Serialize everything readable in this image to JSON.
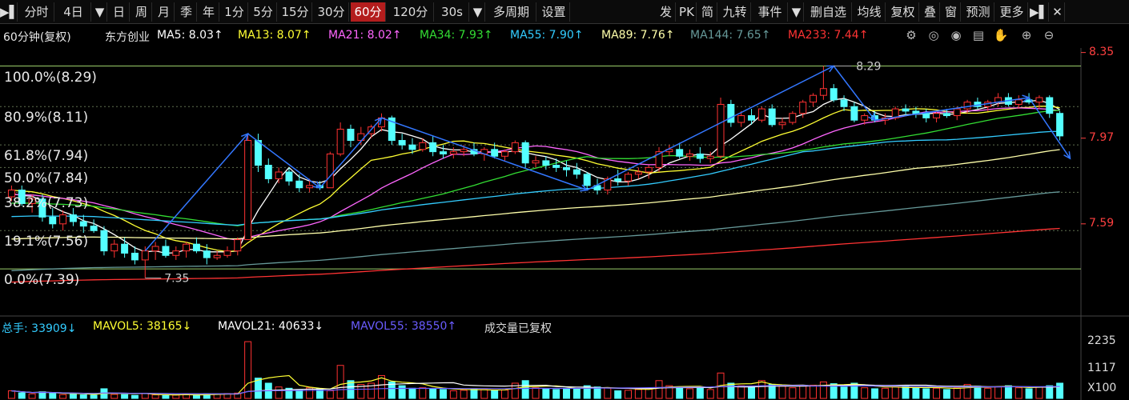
{
  "toolbar": {
    "items": [
      {
        "label": "▶▌",
        "icon": "play-bar-icon"
      },
      {
        "label": "分时"
      },
      {
        "label": "4日"
      },
      {
        "label": "▼",
        "icon": "chevron-down-icon"
      },
      {
        "label": "日"
      },
      {
        "label": "周"
      },
      {
        "label": "月"
      },
      {
        "label": "季"
      },
      {
        "label": "年"
      },
      {
        "label": "1分"
      },
      {
        "label": "5分"
      },
      {
        "label": "15分"
      },
      {
        "label": "30分"
      },
      {
        "label": "60分",
        "active": true
      },
      {
        "label": "120分"
      },
      {
        "label": "30s"
      },
      {
        "label": "▼",
        "icon": "chevron-down-icon"
      },
      {
        "label": "多周期"
      },
      {
        "label": "设置"
      },
      {
        "label": "发"
      },
      {
        "label": "PK"
      },
      {
        "label": "简"
      },
      {
        "label": "九转"
      },
      {
        "label": "事件"
      },
      {
        "label": "▼",
        "icon": "chevron-down-icon"
      },
      {
        "label": "删自选"
      },
      {
        "label": "均线"
      },
      {
        "label": "复权"
      },
      {
        "label": "叠"
      },
      {
        "label": "窗"
      },
      {
        "label": "预测"
      },
      {
        "label": "更多"
      },
      {
        "label": "▶▌",
        "icon": "play-bar-icon"
      },
      {
        "label": "✕",
        "icon": "close-icon"
      }
    ]
  },
  "header": {
    "period": "60分钟(复权)",
    "stock": "东方创业",
    "ma": [
      {
        "label": "MA5: 8.03↑",
        "color": "#ffffff"
      },
      {
        "label": "MA13: 8.07↑",
        "color": "#ffff33"
      },
      {
        "label": "MA21: 8.02↑",
        "color": "#ff66ff"
      },
      {
        "label": "MA34: 7.93↑",
        "color": "#33dd33"
      },
      {
        "label": "MA55: 7.90↑",
        "color": "#33ccff"
      },
      {
        "label": "MA89: 7.76↑",
        "color": "#ffffaa"
      },
      {
        "label": "MA144: 7.65↑",
        "color": "#669999"
      },
      {
        "label": "MA233: 7.44↑",
        "color": "#ff3333"
      }
    ],
    "controls": [
      "gear-icon",
      "eye-circle-icon",
      "eye-icon",
      "clipboard-icon",
      "hand-icon",
      "zoom-in-icon",
      "zoom-out-icon"
    ]
  },
  "chart_data": {
    "type": "candlestick",
    "price_axis": {
      "ticks": [
        8.35,
        7.97,
        7.59
      ],
      "ylim": [
        7.27,
        8.37
      ]
    },
    "fibonacci": [
      {
        "label": "100.0%(8.29)",
        "price": 8.29
      },
      {
        "label": "80.9%(8.11)",
        "price": 8.11
      },
      {
        "label": "61.8%(7.94)",
        "price": 7.94
      },
      {
        "label": "50.0%(7.84)",
        "price": 7.84
      },
      {
        "label": "38.2%(7.73)",
        "price": 7.73
      },
      {
        "label": "19.1%(7.56)",
        "price": 7.56
      },
      {
        "label": "0.0%(7.39)",
        "price": 7.39
      }
    ],
    "annotations": [
      {
        "label": "8.29",
        "price": 8.29
      },
      {
        "label": "7.35",
        "price": 7.35
      }
    ],
    "candles": [
      [
        7.71,
        7.76,
        7.69,
        7.74
      ],
      [
        7.74,
        7.76,
        7.67,
        7.68
      ],
      [
        7.68,
        7.72,
        7.64,
        7.7
      ],
      [
        7.7,
        7.72,
        7.6,
        7.62
      ],
      [
        7.62,
        7.66,
        7.57,
        7.59
      ],
      [
        7.59,
        7.65,
        7.56,
        7.63
      ],
      [
        7.63,
        7.66,
        7.58,
        7.6
      ],
      [
        7.6,
        7.63,
        7.55,
        7.58
      ],
      [
        7.58,
        7.61,
        7.55,
        7.56
      ],
      [
        7.56,
        7.58,
        7.45,
        7.47
      ],
      [
        7.47,
        7.52,
        7.44,
        7.5
      ],
      [
        7.5,
        7.53,
        7.44,
        7.46
      ],
      [
        7.46,
        7.49,
        7.41,
        7.43
      ],
      [
        7.43,
        7.49,
        7.35,
        7.47
      ],
      [
        7.47,
        7.51,
        7.43,
        7.49
      ],
      [
        7.49,
        7.52,
        7.44,
        7.45
      ],
      [
        7.45,
        7.49,
        7.43,
        7.47
      ],
      [
        7.47,
        7.51,
        7.44,
        7.5
      ],
      [
        7.5,
        7.53,
        7.46,
        7.47
      ],
      [
        7.47,
        7.5,
        7.41,
        7.44
      ],
      [
        7.44,
        7.47,
        7.43,
        7.45
      ],
      [
        7.45,
        7.49,
        7.44,
        7.47
      ],
      [
        7.47,
        7.53,
        7.45,
        7.52
      ],
      [
        7.52,
        7.99,
        7.52,
        7.96
      ],
      [
        7.96,
        7.99,
        7.82,
        7.85
      ],
      [
        7.85,
        7.88,
        7.77,
        7.79
      ],
      [
        7.79,
        7.84,
        7.77,
        7.82
      ],
      [
        7.82,
        7.84,
        7.76,
        7.78
      ],
      [
        7.78,
        7.81,
        7.73,
        7.75
      ],
      [
        7.75,
        7.79,
        7.73,
        7.76
      ],
      [
        7.76,
        7.78,
        7.74,
        7.75
      ],
      [
        7.75,
        7.91,
        7.75,
        7.9
      ],
      [
        7.9,
        8.04,
        7.89,
        8.01
      ],
      [
        8.01,
        8.03,
        7.93,
        7.96
      ],
      [
        7.96,
        8.02,
        7.94,
        7.99
      ],
      [
        7.99,
        8.03,
        7.97,
        8.02
      ],
      [
        8.02,
        8.08,
        8.0,
        8.06
      ],
      [
        8.06,
        8.07,
        7.94,
        7.96
      ],
      [
        7.96,
        7.99,
        7.92,
        7.94
      ],
      [
        7.94,
        7.97,
        7.9,
        7.92
      ],
      [
        7.92,
        7.97,
        7.91,
        7.95
      ],
      [
        7.95,
        7.98,
        7.89,
        7.91
      ],
      [
        7.91,
        7.94,
        7.88,
        7.9
      ],
      [
        7.9,
        7.93,
        7.88,
        7.91
      ],
      [
        7.91,
        7.94,
        7.89,
        7.92
      ],
      [
        7.92,
        7.95,
        7.89,
        7.9
      ],
      [
        7.9,
        7.93,
        7.87,
        7.92
      ],
      [
        7.92,
        7.95,
        7.88,
        7.89
      ],
      [
        7.89,
        7.92,
        7.87,
        7.91
      ],
      [
        7.91,
        7.96,
        7.9,
        7.95
      ],
      [
        7.95,
        7.96,
        7.84,
        7.86
      ],
      [
        7.86,
        7.89,
        7.84,
        7.87
      ],
      [
        7.87,
        7.89,
        7.83,
        7.85
      ],
      [
        7.85,
        7.88,
        7.82,
        7.84
      ],
      [
        7.84,
        7.87,
        7.8,
        7.83
      ],
      [
        7.83,
        7.86,
        7.79,
        7.81
      ],
      [
        7.81,
        7.82,
        7.74,
        7.76
      ],
      [
        7.76,
        7.79,
        7.72,
        7.74
      ],
      [
        7.74,
        7.8,
        7.72,
        7.79
      ],
      [
        7.79,
        7.83,
        7.76,
        7.78
      ],
      [
        7.78,
        7.82,
        7.76,
        7.81
      ],
      [
        7.81,
        7.84,
        7.79,
        7.82
      ],
      [
        7.82,
        7.85,
        7.79,
        7.84
      ],
      [
        7.84,
        7.93,
        7.82,
        7.91
      ],
      [
        7.91,
        7.94,
        7.89,
        7.92
      ],
      [
        7.92,
        7.95,
        7.88,
        7.89
      ],
      [
        7.89,
        7.92,
        7.87,
        7.9
      ],
      [
        7.9,
        7.93,
        7.86,
        7.88
      ],
      [
        7.88,
        7.91,
        7.86,
        7.89
      ],
      [
        7.89,
        8.15,
        7.88,
        8.12
      ],
      [
        8.12,
        8.14,
        8.02,
        8.04
      ],
      [
        8.04,
        8.09,
        8.02,
        8.07
      ],
      [
        8.07,
        8.1,
        8.03,
        8.05
      ],
      [
        8.05,
        8.11,
        8.04,
        8.1
      ],
      [
        8.1,
        8.12,
        8.02,
        8.03
      ],
      [
        8.03,
        8.06,
        8.01,
        8.04
      ],
      [
        8.04,
        8.09,
        8.03,
        8.08
      ],
      [
        8.08,
        8.14,
        8.06,
        8.13
      ],
      [
        8.13,
        8.17,
        8.11,
        8.16
      ],
      [
        8.16,
        8.29,
        8.14,
        8.19
      ],
      [
        8.19,
        8.21,
        8.13,
        8.14
      ],
      [
        8.14,
        8.16,
        8.09,
        8.11
      ],
      [
        8.11,
        8.13,
        8.04,
        8.05
      ],
      [
        8.05,
        8.08,
        8.03,
        8.07
      ],
      [
        8.07,
        8.09,
        8.04,
        8.05
      ],
      [
        8.05,
        8.08,
        8.03,
        8.06
      ],
      [
        8.06,
        8.11,
        8.05,
        8.1
      ],
      [
        8.1,
        8.12,
        8.07,
        8.09
      ],
      [
        8.09,
        8.11,
        8.06,
        8.08
      ],
      [
        8.08,
        8.1,
        8.04,
        8.06
      ],
      [
        8.06,
        8.09,
        8.04,
        8.08
      ],
      [
        8.08,
        8.1,
        8.06,
        8.07
      ],
      [
        8.07,
        8.11,
        8.05,
        8.1
      ],
      [
        8.1,
        8.14,
        8.08,
        8.13
      ],
      [
        8.13,
        8.15,
        8.1,
        8.11
      ],
      [
        8.11,
        8.14,
        8.09,
        8.13
      ],
      [
        8.13,
        8.17,
        8.11,
        8.15
      ],
      [
        8.15,
        8.17,
        8.11,
        8.12
      ],
      [
        8.12,
        8.16,
        8.1,
        8.14
      ],
      [
        8.14,
        8.17,
        8.12,
        8.13
      ],
      [
        8.13,
        8.16,
        8.1,
        8.15
      ],
      [
        8.15,
        8.16,
        8.06,
        8.08
      ],
      [
        8.08,
        8.09,
        7.96,
        7.98
      ]
    ],
    "volume": {
      "ylim": [
        0,
        2300
      ],
      "ticks": [
        "2235",
        "1117",
        "X100"
      ],
      "values": [
        300,
        220,
        180,
        260,
        200,
        150,
        170,
        140,
        130,
        380,
        160,
        150,
        120,
        200,
        140,
        110,
        130,
        160,
        140,
        180,
        170,
        190,
        210,
        2235,
        800,
        600,
        450,
        400,
        350,
        420,
        380,
        300,
        1300,
        700,
        550,
        600,
        900,
        650,
        500,
        400,
        420,
        380,
        350,
        300,
        320,
        380,
        350,
        300,
        330,
        600,
        700,
        420,
        380,
        350,
        400,
        380,
        500,
        450,
        420,
        300,
        320,
        350,
        380,
        700,
        500,
        400,
        380,
        420,
        350,
        1000,
        600,
        500,
        450,
        700,
        550,
        480,
        420,
        500,
        520,
        650,
        580,
        450,
        600,
        420,
        380,
        400,
        450,
        500,
        420,
        380,
        400,
        350,
        420,
        550,
        480,
        400,
        450,
        500,
        420,
        380,
        450,
        500,
        600
      ]
    }
  },
  "volume_header": {
    "total": "总手: 33909↓",
    "mavol5": "MAVOL5: 38165↓",
    "mavol21": "MAVOL21: 40633↓",
    "mavol55": "MAVOL55: 38550↑",
    "note": "成交量已复权"
  },
  "colors": {
    "up": "#ff3232",
    "down": "#54ffff",
    "ma5": "#ffffff",
    "ma13": "#ffff33",
    "ma21": "#ff66ff",
    "ma34": "#33dd33",
    "ma55": "#33ccff",
    "ma89": "#ffffaa",
    "ma144": "#669999",
    "ma233": "#ff3333",
    "trend": "#3377ff",
    "mavol5": "#ffff33",
    "mavol21": "#ffffff",
    "mavol55": "#6a5cff"
  }
}
